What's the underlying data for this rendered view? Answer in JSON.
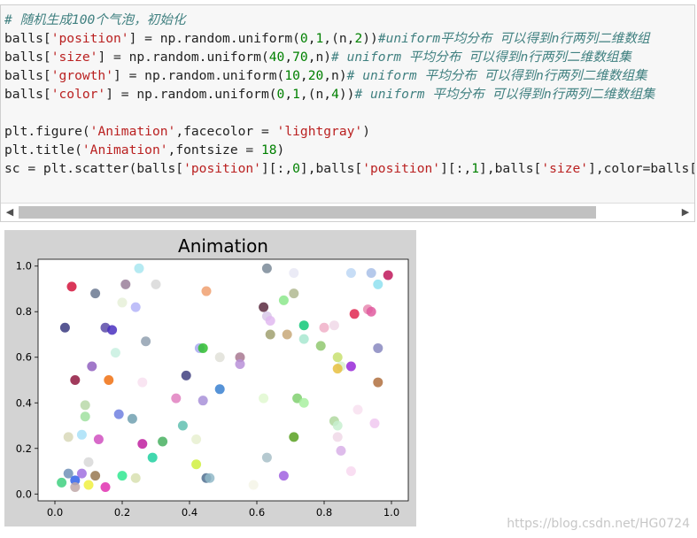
{
  "code_lines": [
    [
      {
        "t": "# 随机生成100个气泡，初始化",
        "c": "c-comment"
      }
    ],
    [
      {
        "t": "balls["
      },
      {
        "t": "'position'",
        "c": "c-str"
      },
      {
        "t": "] = np.random.uniform("
      },
      {
        "t": "0",
        "c": "c-num"
      },
      {
        "t": ","
      },
      {
        "t": "1",
        "c": "c-num"
      },
      {
        "t": ",(n,"
      },
      {
        "t": "2",
        "c": "c-num"
      },
      {
        "t": "))"
      },
      {
        "t": "#uniform平均分布 可以得到n行两列二维数组",
        "c": "c-comment"
      }
    ],
    [
      {
        "t": "balls["
      },
      {
        "t": "'size'",
        "c": "c-str"
      },
      {
        "t": "] = np.random.uniform("
      },
      {
        "t": "40",
        "c": "c-num"
      },
      {
        "t": ","
      },
      {
        "t": "70",
        "c": "c-num"
      },
      {
        "t": ",n)"
      },
      {
        "t": "# uniform 平均分布 可以得到n行两列二维数组集",
        "c": "c-comment"
      }
    ],
    [
      {
        "t": "balls["
      },
      {
        "t": "'growth'",
        "c": "c-str"
      },
      {
        "t": "] = np.random.uniform("
      },
      {
        "t": "10",
        "c": "c-num"
      },
      {
        "t": ","
      },
      {
        "t": "20",
        "c": "c-num"
      },
      {
        "t": ",n)"
      },
      {
        "t": "# uniform 平均分布 可以得到n行两列二维数组集",
        "c": "c-comment"
      }
    ],
    [
      {
        "t": "balls["
      },
      {
        "t": "'color'",
        "c": "c-str"
      },
      {
        "t": "] = np.random.uniform("
      },
      {
        "t": "0",
        "c": "c-num"
      },
      {
        "t": ","
      },
      {
        "t": "1",
        "c": "c-num"
      },
      {
        "t": ",(n,"
      },
      {
        "t": "4",
        "c": "c-num"
      },
      {
        "t": "))"
      },
      {
        "t": "# uniform 平均分布 可以得到n行两列二维数组集",
        "c": "c-comment"
      }
    ],
    [],
    [
      {
        "t": "plt.figure("
      },
      {
        "t": "'Animation'",
        "c": "c-str"
      },
      {
        "t": ",facecolor = "
      },
      {
        "t": "'lightgray'",
        "c": "c-str"
      },
      {
        "t": ")"
      }
    ],
    [
      {
        "t": "plt.title("
      },
      {
        "t": "'Animation'",
        "c": "c-str"
      },
      {
        "t": ",fontsize = "
      },
      {
        "t": "18",
        "c": "c-num"
      },
      {
        "t": ")"
      }
    ],
    [
      {
        "t": "sc = plt.scatter(balls["
      },
      {
        "t": "'position'",
        "c": "c-str"
      },
      {
        "t": "][:,"
      },
      {
        "t": "0",
        "c": "c-num"
      },
      {
        "t": "],balls["
      },
      {
        "t": "'position'",
        "c": "c-str"
      },
      {
        "t": "][:,"
      },
      {
        "t": "1",
        "c": "c-num"
      },
      {
        "t": "],balls["
      },
      {
        "t": "'size'",
        "c": "c-str"
      },
      {
        "t": "],color=balls["
      }
    ]
  ],
  "scrollbar": {
    "left_arrow": "◀",
    "right_arrow": "▶"
  },
  "watermark": "https://blog.csdn.net/HG0724",
  "chart_data": {
    "type": "scatter",
    "title": "Animation",
    "xlabel": "",
    "ylabel": "",
    "xlim": [
      -0.05,
      1.05
    ],
    "ylim": [
      -0.03,
      1.03
    ],
    "xticks": [
      "0.0",
      "0.2",
      "0.4",
      "0.6",
      "0.8",
      "1.0"
    ],
    "yticks": [
      "0.0",
      "0.2",
      "0.4",
      "0.6",
      "0.8",
      "1.0"
    ],
    "facecolor": "#d3d3d3",
    "grid": false,
    "points": [
      {
        "x": 0.25,
        "y": 0.99,
        "c": "#a8e6f0"
      },
      {
        "x": 0.63,
        "y": 0.99,
        "c": "#7a8a98"
      },
      {
        "x": 0.71,
        "y": 0.97,
        "c": "#e8e8f4"
      },
      {
        "x": 0.88,
        "y": 0.97,
        "c": "#bdd7f5"
      },
      {
        "x": 0.94,
        "y": 0.97,
        "c": "#a8c0e8"
      },
      {
        "x": 0.99,
        "y": 0.96,
        "c": "#c0185a"
      },
      {
        "x": 0.05,
        "y": 0.91,
        "c": "#d4143c"
      },
      {
        "x": 0.21,
        "y": 0.92,
        "c": "#9a7f9a"
      },
      {
        "x": 0.3,
        "y": 0.92,
        "c": "#d8d8d8"
      },
      {
        "x": 0.96,
        "y": 0.92,
        "c": "#8fe0f0"
      },
      {
        "x": 0.12,
        "y": 0.88,
        "c": "#6a7890"
      },
      {
        "x": 0.45,
        "y": 0.89,
        "c": "#f0a070"
      },
      {
        "x": 0.71,
        "y": 0.88,
        "c": "#b0b890"
      },
      {
        "x": 0.2,
        "y": 0.84,
        "c": "#e6f0d8"
      },
      {
        "x": 0.24,
        "y": 0.82,
        "c": "#b4b4f8"
      },
      {
        "x": 0.62,
        "y": 0.82,
        "c": "#5a2a40"
      },
      {
        "x": 0.68,
        "y": 0.85,
        "c": "#8ce88c"
      },
      {
        "x": 0.89,
        "y": 0.79,
        "c": "#e02850"
      },
      {
        "x": 0.93,
        "y": 0.81,
        "c": "#e88ab0"
      },
      {
        "x": 0.94,
        "y": 0.8,
        "c": "#e05ca0"
      },
      {
        "x": 0.63,
        "y": 0.78,
        "c": "#d8c8e8"
      },
      {
        "x": 0.64,
        "y": 0.76,
        "c": "#e0b8f0"
      },
      {
        "x": 0.03,
        "y": 0.73,
        "c": "#3a3a80"
      },
      {
        "x": 0.15,
        "y": 0.73,
        "c": "#5a4aa8"
      },
      {
        "x": 0.17,
        "y": 0.72,
        "c": "#4a30c0"
      },
      {
        "x": 0.74,
        "y": 0.74,
        "c": "#10c878"
      },
      {
        "x": 0.8,
        "y": 0.73,
        "c": "#f0b0c8"
      },
      {
        "x": 0.83,
        "y": 0.74,
        "c": "#f0d8e8"
      },
      {
        "x": 0.64,
        "y": 0.7,
        "c": "#a0a070"
      },
      {
        "x": 0.69,
        "y": 0.7,
        "c": "#c8a878"
      },
      {
        "x": 0.74,
        "y": 0.68,
        "c": "#a8e8d0"
      },
      {
        "x": 0.27,
        "y": 0.67,
        "c": "#90a0b0"
      },
      {
        "x": 0.43,
        "y": 0.64,
        "c": "#a8a8f0"
      },
      {
        "x": 0.44,
        "y": 0.64,
        "c": "#30c030"
      },
      {
        "x": 0.79,
        "y": 0.65,
        "c": "#90c870"
      },
      {
        "x": 0.96,
        "y": 0.64,
        "c": "#8888c0"
      },
      {
        "x": 0.18,
        "y": 0.62,
        "c": "#c8f0e0"
      },
      {
        "x": 0.49,
        "y": 0.6,
        "c": "#e0e0d8"
      },
      {
        "x": 0.55,
        "y": 0.6,
        "c": "#a87890"
      },
      {
        "x": 0.55,
        "y": 0.57,
        "c": "#b890d8"
      },
      {
        "x": 0.84,
        "y": 0.6,
        "c": "#c8e070"
      },
      {
        "x": 0.11,
        "y": 0.56,
        "c": "#9060c0"
      },
      {
        "x": 0.85,
        "y": 0.56,
        "c": "#d8f0d0"
      },
      {
        "x": 0.84,
        "y": 0.55,
        "c": "#e8c040"
      },
      {
        "x": 0.88,
        "y": 0.56,
        "c": "#9828d8"
      },
      {
        "x": 0.39,
        "y": 0.52,
        "c": "#404080"
      },
      {
        "x": 0.06,
        "y": 0.5,
        "c": "#901840"
      },
      {
        "x": 0.16,
        "y": 0.5,
        "c": "#f07010"
      },
      {
        "x": 0.26,
        "y": 0.49,
        "c": "#f8e0f0"
      },
      {
        "x": 0.96,
        "y": 0.49,
        "c": "#b07040"
      },
      {
        "x": 0.49,
        "y": 0.46,
        "c": "#3880d0"
      },
      {
        "x": 0.36,
        "y": 0.42,
        "c": "#e080c0"
      },
      {
        "x": 0.44,
        "y": 0.41,
        "c": "#a890d8"
      },
      {
        "x": 0.62,
        "y": 0.42,
        "c": "#e0f8d0"
      },
      {
        "x": 0.72,
        "y": 0.42,
        "c": "#80d070"
      },
      {
        "x": 0.74,
        "y": 0.4,
        "c": "#a8f0a0"
      },
      {
        "x": 0.09,
        "y": 0.39,
        "c": "#b8d8a8"
      },
      {
        "x": 0.9,
        "y": 0.37,
        "c": "#f8e0f0"
      },
      {
        "x": 0.09,
        "y": 0.34,
        "c": "#a0e0a0"
      },
      {
        "x": 0.19,
        "y": 0.35,
        "c": "#7080e0"
      },
      {
        "x": 0.23,
        "y": 0.33,
        "c": "#70a0b0"
      },
      {
        "x": 0.38,
        "y": 0.3,
        "c": "#60c0b0"
      },
      {
        "x": 0.83,
        "y": 0.32,
        "c": "#b0d8a0"
      },
      {
        "x": 0.84,
        "y": 0.3,
        "c": "#c8f0d0"
      },
      {
        "x": 0.95,
        "y": 0.31,
        "c": "#f0c8f0"
      },
      {
        "x": 0.04,
        "y": 0.25,
        "c": "#d8d8b8"
      },
      {
        "x": 0.08,
        "y": 0.26,
        "c": "#a8e0f8"
      },
      {
        "x": 0.13,
        "y": 0.24,
        "c": "#d050c0"
      },
      {
        "x": 0.26,
        "y": 0.22,
        "c": "#c020a0"
      },
      {
        "x": 0.32,
        "y": 0.23,
        "c": "#48b060"
      },
      {
        "x": 0.42,
        "y": 0.24,
        "c": "#e8f0d0"
      },
      {
        "x": 0.71,
        "y": 0.25,
        "c": "#58a020"
      },
      {
        "x": 0.84,
        "y": 0.25,
        "c": "#f0d8e8"
      },
      {
        "x": 0.85,
        "y": 0.19,
        "c": "#d8b0e8"
      },
      {
        "x": 0.29,
        "y": 0.16,
        "c": "#20d0a0"
      },
      {
        "x": 0.63,
        "y": 0.16,
        "c": "#a8c0c8"
      },
      {
        "x": 0.1,
        "y": 0.14,
        "c": "#d8d8d8"
      },
      {
        "x": 0.42,
        "y": 0.13,
        "c": "#d0f040"
      },
      {
        "x": 0.88,
        "y": 0.1,
        "c": "#f8d8f0"
      },
      {
        "x": 0.04,
        "y": 0.09,
        "c": "#7090b8"
      },
      {
        "x": 0.08,
        "y": 0.09,
        "c": "#a070e0"
      },
      {
        "x": 0.12,
        "y": 0.08,
        "c": "#987850"
      },
      {
        "x": 0.2,
        "y": 0.08,
        "c": "#30e890"
      },
      {
        "x": 0.24,
        "y": 0.07,
        "c": "#d8e0b0"
      },
      {
        "x": 0.45,
        "y": 0.07,
        "c": "#507090"
      },
      {
        "x": 0.46,
        "y": 0.07,
        "c": "#90b8c8"
      },
      {
        "x": 0.68,
        "y": 0.08,
        "c": "#a060e0"
      },
      {
        "x": 0.02,
        "y": 0.05,
        "c": "#40d080"
      },
      {
        "x": 0.06,
        "y": 0.06,
        "c": "#3060e8"
      },
      {
        "x": 0.06,
        "y": 0.03,
        "c": "#c0a8a8"
      },
      {
        "x": 0.1,
        "y": 0.04,
        "c": "#f0f040"
      },
      {
        "x": 0.15,
        "y": 0.03,
        "c": "#e030b0"
      },
      {
        "x": 0.59,
        "y": 0.04,
        "c": "#f4f4e8"
      }
    ]
  }
}
